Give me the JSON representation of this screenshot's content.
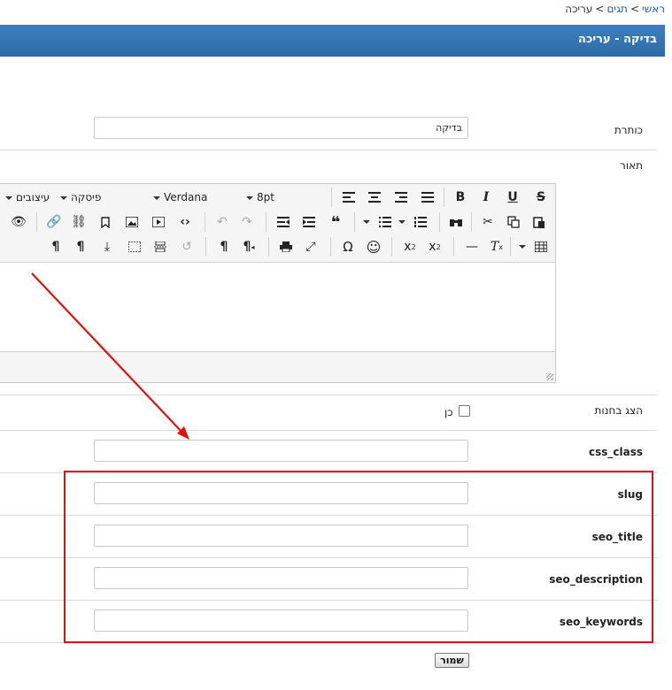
{
  "breadcrumb": {
    "home": "ראשי",
    "tags": "תגים",
    "current": "עריכה",
    "separator": ">"
  },
  "header": {
    "title": "בדיקה - עריכה"
  },
  "form": {
    "title": {
      "label": "כותרת",
      "value": "בדיקה"
    },
    "description": {
      "label": "תאור"
    },
    "show_in_stores": {
      "label": "הצג בחנות",
      "checkbox_label": "כן",
      "checked": false
    },
    "css_class": {
      "label": "css_class",
      "value": ""
    },
    "slug": {
      "label": "slug",
      "value": ""
    },
    "seo_title": {
      "label": "seo_title",
      "value": ""
    },
    "seo_description": {
      "label": "seo_description",
      "value": ""
    },
    "seo_keywords": {
      "label": "seo_keywords",
      "value": ""
    },
    "save_label": "שמור"
  },
  "editor": {
    "font_size": "8pt",
    "font_family": "Verdana",
    "paragraph": "פיסקה",
    "styles": "עיצובים",
    "buttons": {
      "bold": "B",
      "italic": "I",
      "underline": "U",
      "strike": "S",
      "quote": "❝",
      "pilcrow": "¶",
      "omega": "Ω",
      "smiley": "☺",
      "subscript": "x",
      "superscript": "x",
      "hr": "—",
      "clear": "T"
    }
  },
  "colors": {
    "header": "#2d6aa8",
    "link": "#1f5fa8",
    "annotation": "#e01010"
  }
}
